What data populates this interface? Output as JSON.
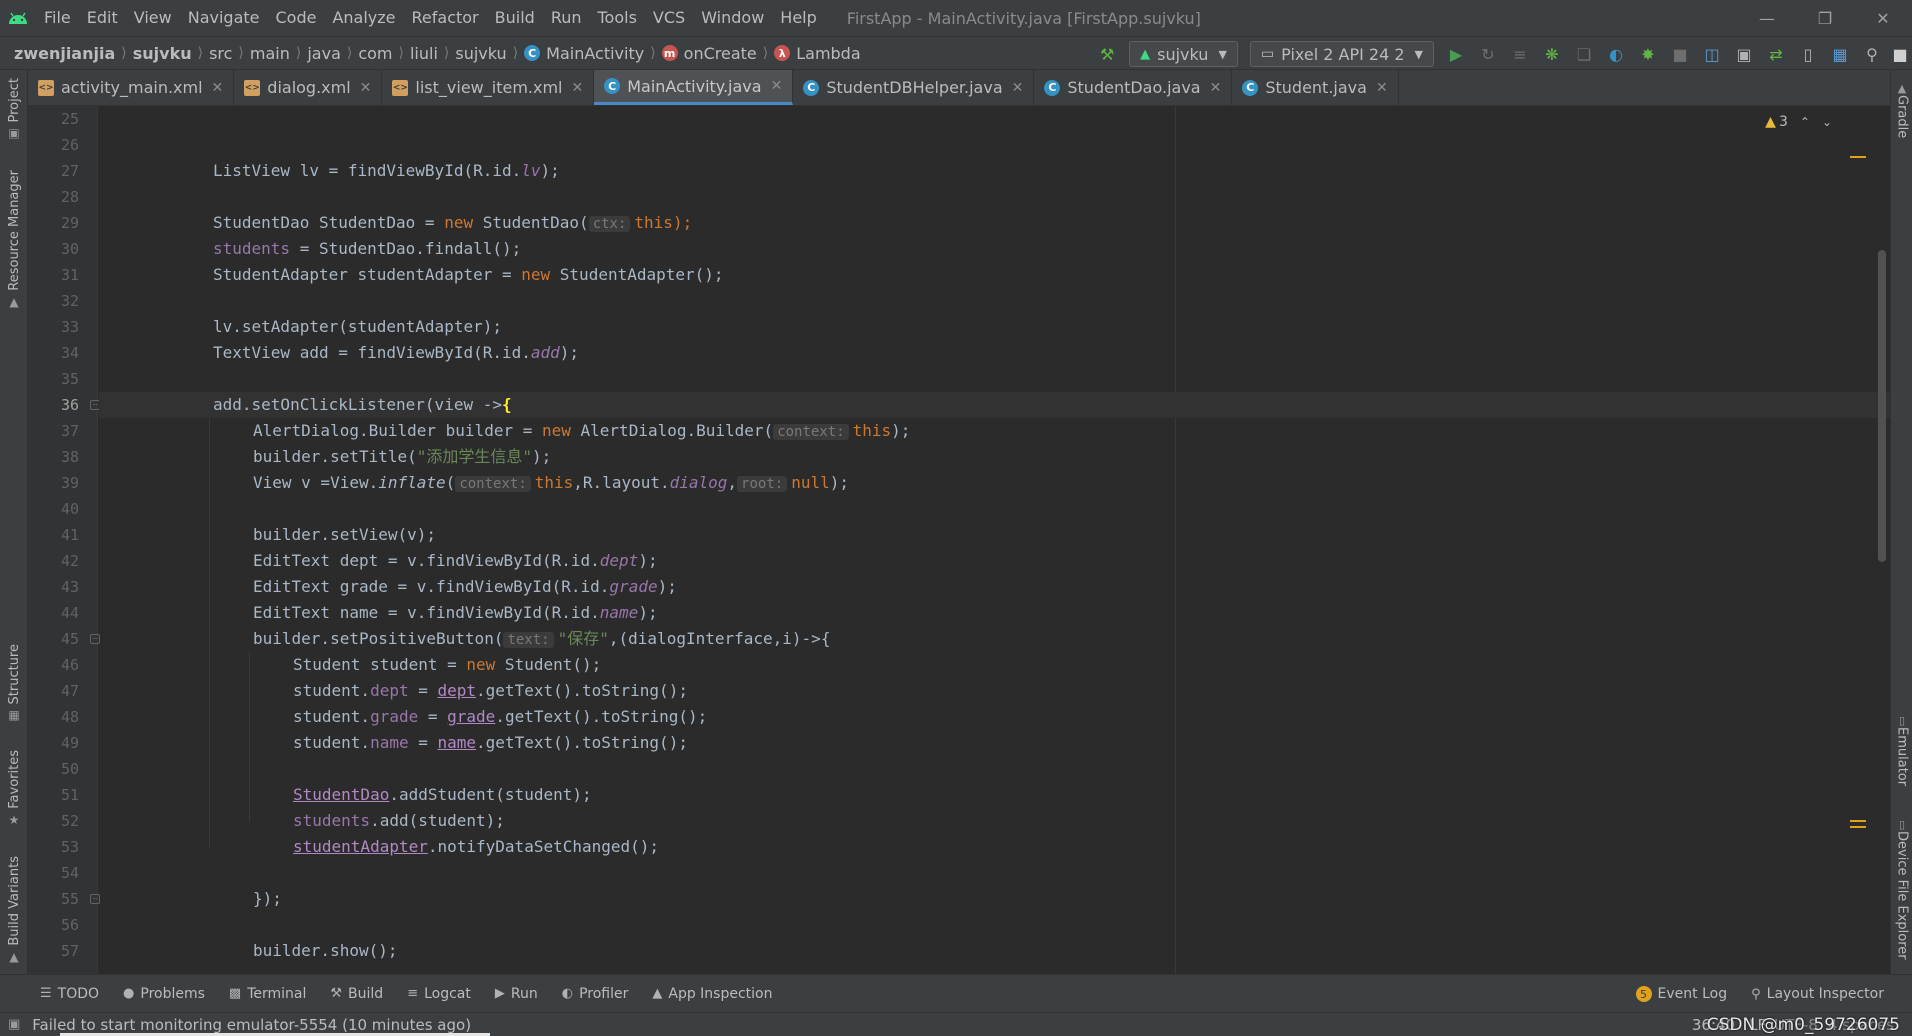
{
  "menu": {
    "items": [
      "File",
      "Edit",
      "View",
      "Navigate",
      "Code",
      "Analyze",
      "Refactor",
      "Build",
      "Run",
      "Tools",
      "VCS",
      "Window",
      "Help"
    ],
    "window_title": "FirstApp - MainActivity.java [FirstApp.sujvku]"
  },
  "breadcrumb": {
    "items": [
      "zwenjianjia",
      "sujvku",
      "src",
      "main",
      "java",
      "com",
      "liuli",
      "sujvku",
      "MainActivity",
      "onCreate",
      "Lambda"
    ]
  },
  "toolbar": {
    "run_config": "sujvku",
    "device": "Pixel 2 API 24 2"
  },
  "left_tools": [
    "Project",
    "Resource Manager",
    "Structure",
    "Favorites",
    "Build Variants"
  ],
  "right_tools": [
    "Gradle",
    "Emulator",
    "Device File Explorer"
  ],
  "tabs": [
    {
      "label": "activity_main.xml",
      "type": "xml"
    },
    {
      "label": "dialog.xml",
      "type": "xml"
    },
    {
      "label": "list_view_item.xml",
      "type": "xml"
    },
    {
      "label": "MainActivity.java",
      "type": "java"
    },
    {
      "label": "StudentDBHelper.java",
      "type": "java"
    },
    {
      "label": "StudentDao.java",
      "type": "java"
    },
    {
      "label": "Student.java",
      "type": "java"
    }
  ],
  "active_tab": 3,
  "editor": {
    "warning_count": "3",
    "current_line": 36,
    "line_numbers": [
      "25",
      "26",
      "27",
      "28",
      "29",
      "30",
      "31",
      "32",
      "33",
      "34",
      "35",
      "36",
      "37",
      "38",
      "39",
      "40",
      "41",
      "42",
      "43",
      "44",
      "45",
      "46",
      "47",
      "48",
      "49",
      "50",
      "51",
      "52",
      "53",
      "54",
      "55",
      "56",
      "57"
    ],
    "code": {
      "l27": "ListView lv = findViewById(R.id.",
      "l27_f": "lv",
      "l27_e": ");",
      "l29_a": "StudentDao StudentDao = ",
      "l29_new": "new",
      "l29_b": " StudentDao(",
      "l29_hint": "ctx:",
      "l29_this": "this",
      "l29_c": ");",
      "l30_f": "students",
      "l30_b": " = StudentDao.findall();",
      "l31_a": "StudentAdapter studentAdapter = ",
      "l31_new": "new",
      "l31_b": " StudentAdapter();",
      "l33": "lv.setAdapter(studentAdapter);",
      "l34_a": "TextView add = findViewById(R.id.",
      "l34_f": "add",
      "l34_e": ");",
      "l36_a": "add.setOnClickListener(view ->",
      "l36_brace": "{",
      "l37_a": "AlertDialog.Builder builder = ",
      "l37_new": "new",
      "l37_b": " AlertDialog.Builder(",
      "l37_hint": "context:",
      "l37_this": "this",
      "l37_c": ");",
      "l38_a": "builder.setTitle(",
      "l38_str": "\"添加学生信息\"",
      "l38_c": ");",
      "l39_a": "View v =View.",
      "l39_inf": "inflate",
      "l39_b": "(",
      "l39_hint1": "context:",
      "l39_this": "this",
      "l39_c": ",R.layout.",
      "l39_dlg": "dialog",
      "l39_d": ",",
      "l39_hint2": "root:",
      "l39_null": "null",
      "l39_e": ");",
      "l41": "builder.setView(v);",
      "l42_a": "EditText dept = v.findViewById(R.id.",
      "l42_f": "dept",
      "l42_e": ");",
      "l43_a": "EditText grade = v.findViewById(R.id.",
      "l43_f": "grade",
      "l43_e": ");",
      "l44_a": "EditText name = v.findViewById(R.id.",
      "l44_f": "name",
      "l44_e": ");",
      "l45_a": "builder.setPositiveButton(",
      "l45_hint": "text:",
      "l45_str": "\"保存\"",
      "l45_b": ",(dialogInterface,i)->{",
      "l46_a": "Student student = ",
      "l46_new": "new",
      "l46_b": " Student();",
      "l47_a": "student.",
      "l47_f": "dept",
      "l47_b": " = ",
      "l47_u": "dept",
      "l47_c": ".getText().toString();",
      "l48_a": "student.",
      "l48_f": "grade",
      "l48_b": " = ",
      "l48_u": "grade",
      "l48_c": ".getText().toString();",
      "l49_a": "student.",
      "l49_f": "name",
      "l49_b": " = ",
      "l49_u": "name",
      "l49_c": ".getText().toString();",
      "l51_u": "StudentDao",
      "l51_b": ".addStudent(student);",
      "l52_f": "students",
      "l52_b": ".add(student);",
      "l53_u": "studentAdapter",
      "l53_b": ".notifyDataSetChanged();",
      "l55": "});",
      "l57": "builder.show();"
    }
  },
  "bottom_tools": [
    "TODO",
    "Problems",
    "Terminal",
    "Build",
    "Logcat",
    "Run",
    "Profiler",
    "App Inspection"
  ],
  "bottom_right": {
    "event_log_count": "5",
    "event_log": "Event Log",
    "layout_inspector": "Layout Inspector"
  },
  "status": {
    "message": "Failed to start monitoring emulator-5554 (10 minutes ago)",
    "position": "36:40",
    "line_sep": "LF",
    "encoding": "UTF-8",
    "indent": "4 spaces",
    "watermark": "CSDN @m0_59726075"
  },
  "colors": {
    "background": "#2b2b2b",
    "keyword": "#cc7832",
    "field": "#9876aa",
    "string": "#6a8759",
    "accent": "#4a88c7"
  }
}
